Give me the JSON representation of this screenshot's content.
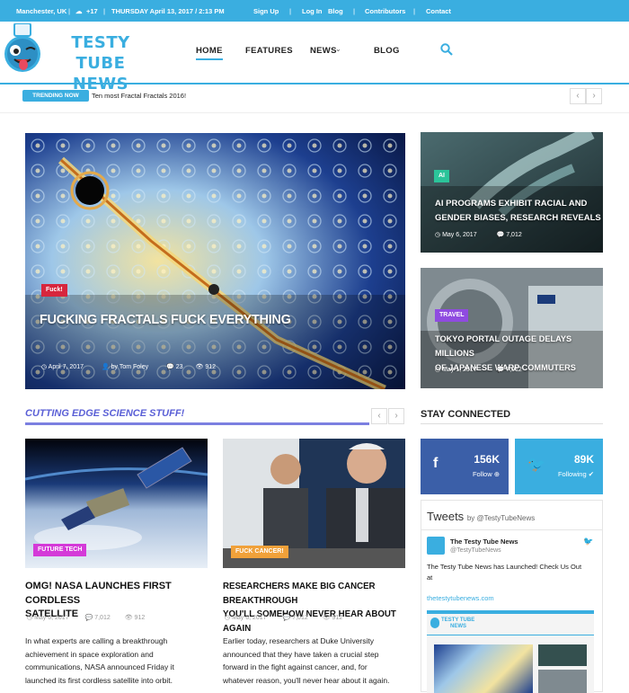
{
  "topbar": {
    "location": "Manchester, UK",
    "weather": "+17",
    "date": "THURSDAY April 13, 2017 / 2:13 PM",
    "sign_up": "Sign Up",
    "log_in": "Log In",
    "blog": "Blog",
    "contributors": "Contributors",
    "contact": "Contact",
    "color": "#3aaee0"
  },
  "logo": {
    "line1": "TESTY TUBE",
    "line2": "NEWS"
  },
  "nav": {
    "home": "HOME",
    "features": "FEATURES",
    "news": "NEWS",
    "blog": "BLOG"
  },
  "trending": {
    "badge": "TRENDING NOW",
    "text": "Ten most Fractal Fractals 2016!"
  },
  "hero": {
    "tag": "Fuck!",
    "title": "FUCKING FRACTALS FUCK EVERYTHING",
    "date": "April 7, 2017",
    "author": "by Tom Foley",
    "comments": "23",
    "views": "912"
  },
  "side1": {
    "tag": "AI",
    "title_l1": "AI PROGRAMS EXHIBIT RACIAL AND",
    "title_l2": "GENDER BIASES, RESEARCH REVEALS",
    "date": "May 6, 2017",
    "views": "7,012"
  },
  "side2": {
    "tag": "TRAVEL",
    "title_l1": "TOKYO PORTAL OUTAGE DELAYS MILLIONS",
    "title_l2": "OF JAPANESE WARP COMMUTERS",
    "date": "May 1, 2017",
    "views": "7,012"
  },
  "section": {
    "title": "CUTTING EDGE SCIENCE STUFF!",
    "stay": "STAY CONNECTED"
  },
  "card1": {
    "tag": "FUTURE TECH",
    "title_l1": "OMG! NASA LAUNCHES FIRST CORDLESS",
    "title_l2": "SATELLITE",
    "date": "May 6, 2017",
    "views": "7,012",
    "comments": "912",
    "body_l1": "In what experts are calling a breakthrough",
    "body_l2": "achievement in space exploration and",
    "body_l3": "communications, NASA announced Friday it",
    "body_l4": "launched its first cordless satellite into orbit."
  },
  "card2": {
    "tag": "FUCK CANCER!",
    "title_l1": "RESEARCHERS MAKE BIG CANCER BREAKTHROUGH",
    "title_l2": "YOU'LL SOMEHOW NEVER HEAR ABOUT AGAIN",
    "date": "May 6, 2017",
    "views": "7,012",
    "comments": "912",
    "body_l1": "Earlier today, researchers at Duke University",
    "body_l2": "announced that they have taken a crucial step",
    "body_l3": "forward in the fight against cancer, and, for",
    "body_l4": "whatever reason, you'll never hear about it again."
  },
  "social": {
    "fb_count": "156K",
    "fb_label": "Follow",
    "tw_count": "89K",
    "tw_label": "Following"
  },
  "tweets": {
    "title": "Tweets",
    "by": "by @TestyTubeNews",
    "account_name": "The Testy Tube News",
    "handle": "@TestyTubeNews",
    "text_l1": "The Testy Tube News has Launched! Check Us Out",
    "text_l2": "at",
    "link": "thetestytubenews.com",
    "preview_logo_l1": "TESTY TUBE",
    "preview_logo_l2": "NEWS"
  }
}
